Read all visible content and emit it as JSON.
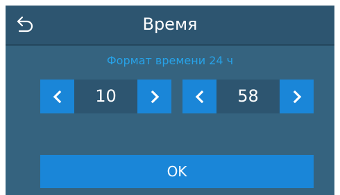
{
  "header": {
    "title": "Время",
    "back_icon": "back-arrow-icon"
  },
  "time_format": {
    "label": "Формат времени 24 ч"
  },
  "hours": {
    "value": "10",
    "decrement_icon": "chevron-left-icon",
    "increment_icon": "chevron-right-icon"
  },
  "minutes": {
    "value": "58",
    "decrement_icon": "chevron-left-icon",
    "increment_icon": "chevron-right-icon"
  },
  "ok_button": {
    "label": "OK"
  },
  "colors": {
    "background": "#35637f",
    "header": "#2d5570",
    "accent": "#1a86d8",
    "label": "#27a2e8",
    "text": "#ffffff"
  }
}
